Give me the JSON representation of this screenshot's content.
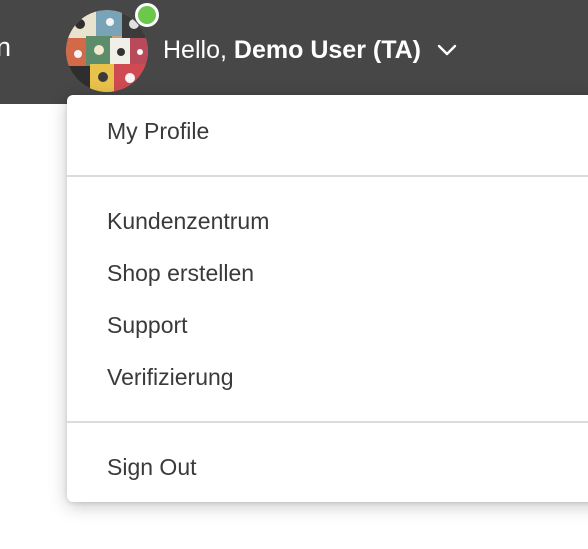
{
  "header": {
    "partial_text": "n",
    "greeting": "Hello,",
    "user_name": "Demo User (TA)",
    "status": "online",
    "avatar_icon": "avatar-icon",
    "chevron_icon": "chevron-down-icon"
  },
  "colors": {
    "topbar": "#474747",
    "presence": "#6bc84a",
    "menu_text": "#3a3a3a",
    "divider": "#dcdcdc"
  },
  "menu": {
    "profile": "My Profile",
    "items": [
      "Kundenzentrum",
      "Shop erstellen",
      "Support",
      "Verifizierung"
    ],
    "sign_out": "Sign Out"
  }
}
